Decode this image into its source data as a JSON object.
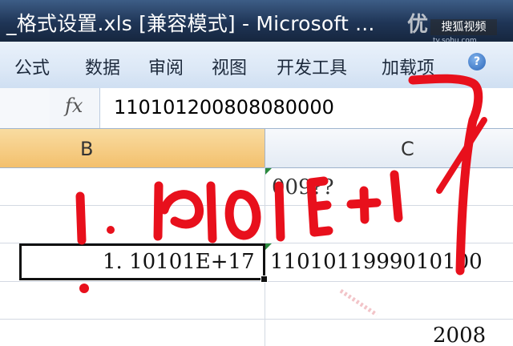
{
  "window": {
    "title": "_格式设置.xls  [兼容模式] - Microsoft ..."
  },
  "watermark": {
    "logo_left": "优",
    "logo_box": "搜狐视频",
    "url": "tv.sohu.com"
  },
  "ribbon": {
    "tabs": [
      "公式",
      "数据",
      "审阅",
      "视图",
      "开发工具",
      "加载项"
    ],
    "help_label": "?"
  },
  "formula_bar": {
    "fx_label": "fx",
    "value": "110101200808080000"
  },
  "columns": {
    "b": "B",
    "c": "C"
  },
  "cells": {
    "c_row1": "009??",
    "b_row3": "1. 10101E+17",
    "c_row3": "1101011999010100",
    "c_row5": "2008"
  },
  "annotation": {
    "handwritten": "1. 10101E+17",
    "color": "#e8101c"
  },
  "colors": {
    "title_bar": "#1f3556",
    "ribbon": "#dce8f6",
    "selected_column_header": "#f3c06d",
    "grid_line": "#d3d9e2"
  }
}
